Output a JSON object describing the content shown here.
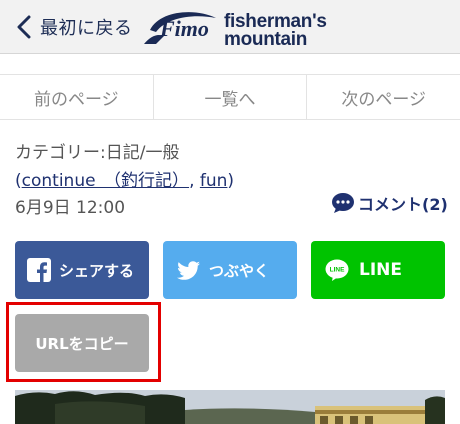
{
  "header": {
    "back_label": "最初に戻る",
    "brand": {
      "mark": "Fimo",
      "line1": "fisherman's",
      "line2": "mountain"
    }
  },
  "pager": {
    "prev": "前のページ",
    "list": "一覧へ",
    "next": "次のページ"
  },
  "post": {
    "category": "カテゴリー:日記/一般",
    "tags_open": "(",
    "tag1": "continue　（釣行記）",
    "tags_sep": ", ",
    "tag2": "fun",
    "tags_close": ")",
    "date": "6月9日 12:00",
    "comment_label": "コメント(2)"
  },
  "share": {
    "facebook": "シェアする",
    "twitter": "つぶやく",
    "line": "LINE",
    "line_icon_text": "LINE",
    "copy_url": "URLをコピー"
  },
  "colors": {
    "facebook": "#3b5998",
    "twitter": "#55acee",
    "line": "#00c300",
    "copy": "#a9a9a9",
    "highlight": "#e30000",
    "brand": "#1a2a55"
  },
  "icons": {
    "back": "chevron-left-icon",
    "comment": "speech-bubble-icon",
    "facebook": "facebook-icon",
    "twitter": "twitter-bird-icon",
    "line": "line-icon"
  }
}
